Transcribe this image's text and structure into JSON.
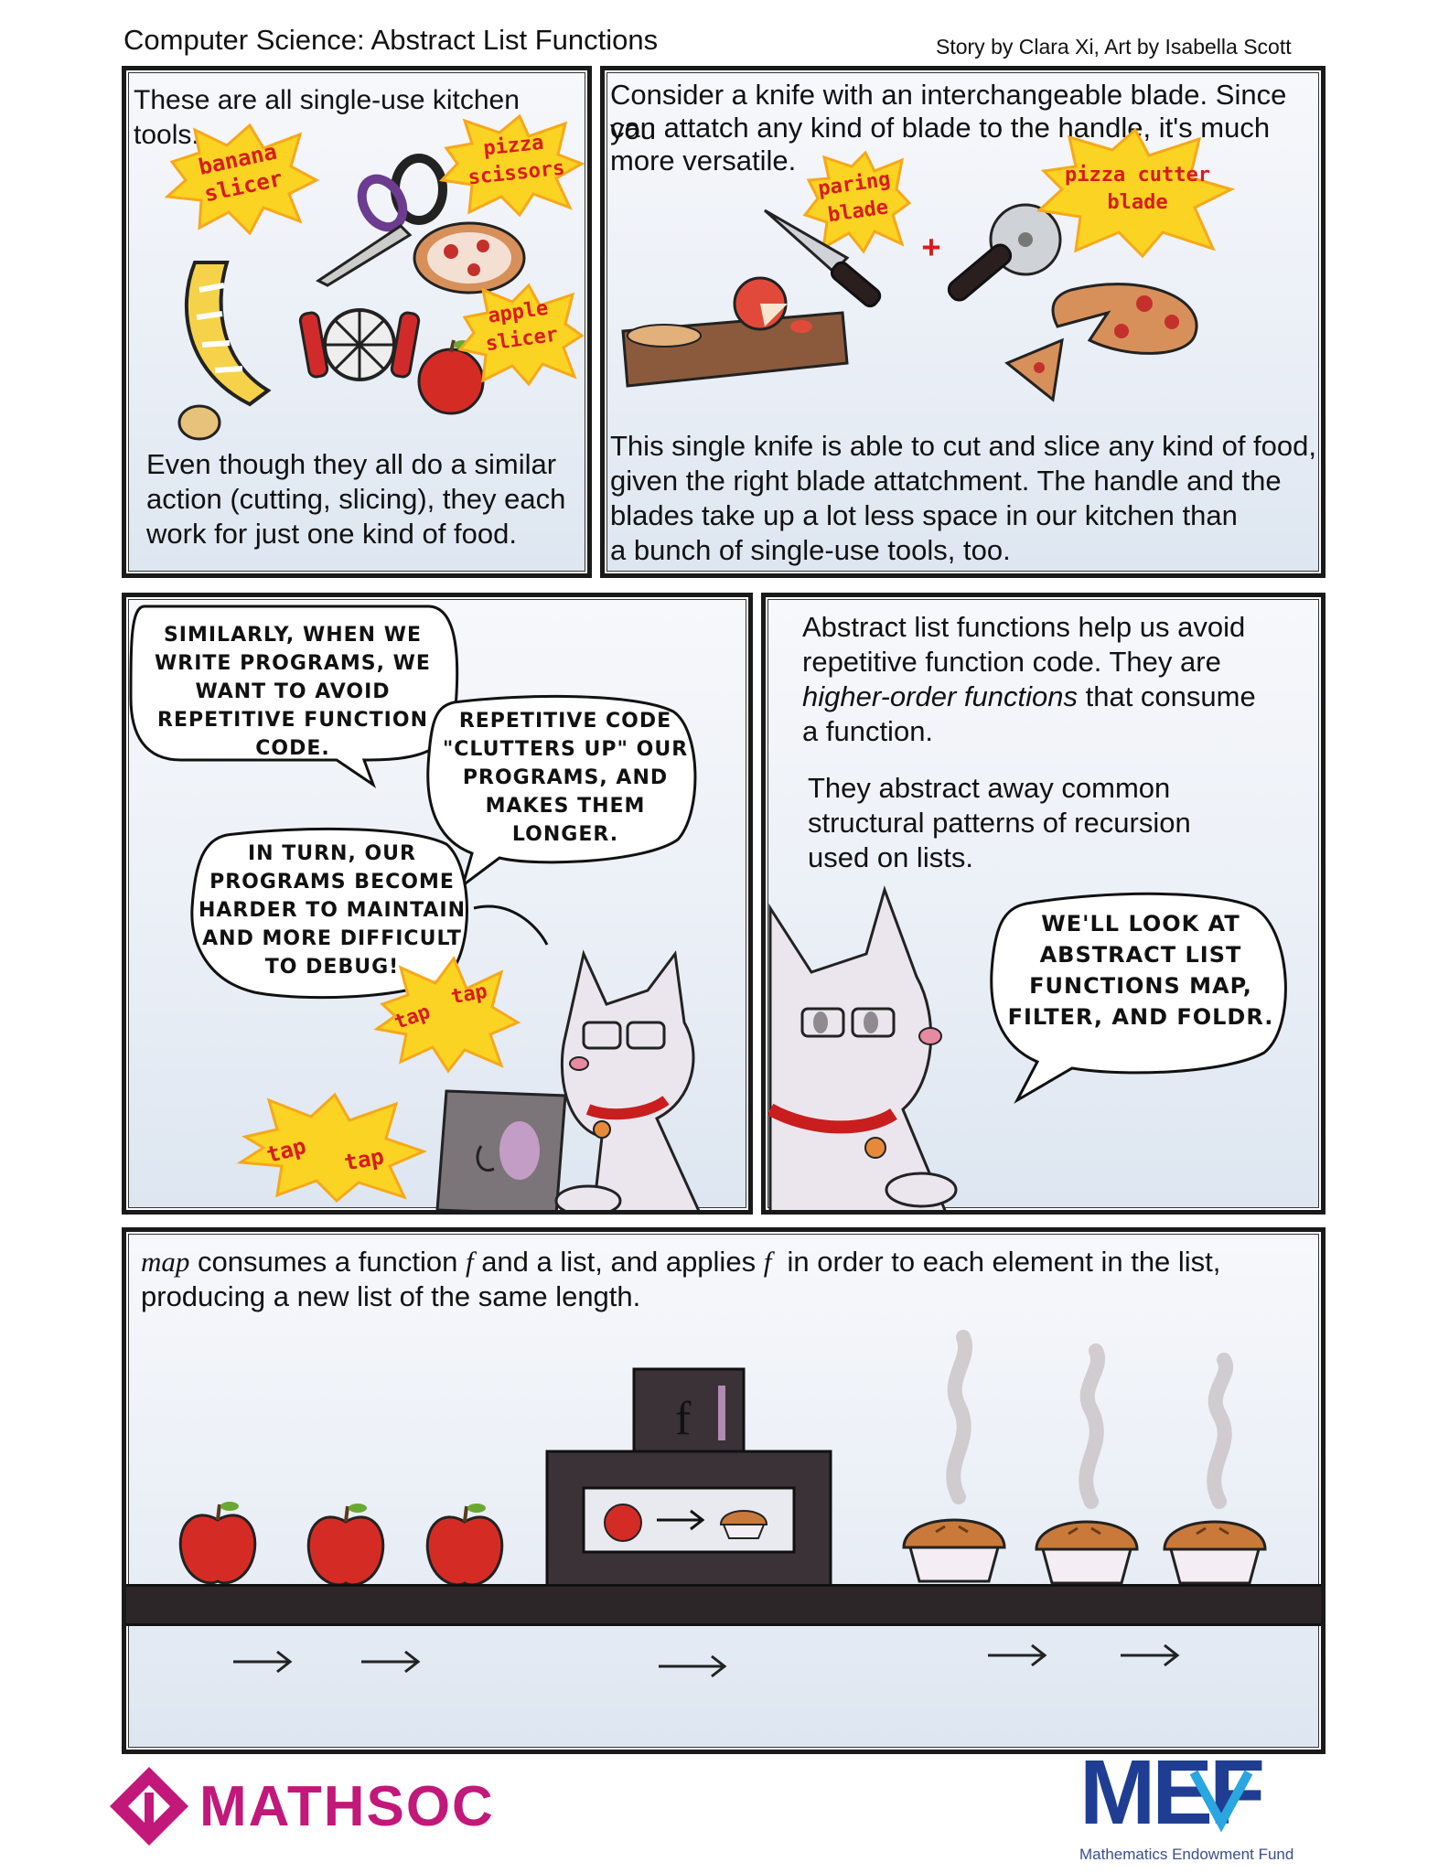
{
  "header": {
    "title": "Computer Science: Abstract List Functions",
    "credits": "Story by Clara Xi, Art by Isabella Scott"
  },
  "panel1": {
    "top_text": "These are all single-use kitchen tools.",
    "labels": {
      "banana": "banana slicer",
      "scissors": "pizza scissors",
      "apple": "apple slicer"
    },
    "bottom_text_1": "Even though they all do a similar",
    "bottom_text_2": "action (cutting, slicing), they each",
    "bottom_text_3": "work for just one kind of food."
  },
  "panel2": {
    "top_text_1": "Consider a knife with an interchangeable blade. Since you",
    "top_text_2": "can attatch any kind of blade to the handle, it's much",
    "top_text_3": "more versatile.",
    "labels": {
      "paring": "paring blade",
      "plus": "+",
      "pizza_cutter": "pizza cutter blade"
    },
    "bottom_text_1": "This single knife is able to cut and slice any kind of food,",
    "bottom_text_2": "given the right blade attatchment. The handle and the",
    "bottom_text_3": "blades take up a lot less space in our kitchen than",
    "bottom_text_4": "a bunch of single-use tools, too."
  },
  "panel3": {
    "bubble1": "Similarly, when we write programs, we want to avoid repetitive function code.",
    "bubble2": "Repetitive code \"clutters up\" our programs, and makes them longer.",
    "bubble3": "In turn, our programs become harder to maintain and more difficult to debug!",
    "tap1": "tap",
    "tap2": "tap",
    "tap3": "tap",
    "tap4": "tap"
  },
  "panel4": {
    "para1_a": "Abstract list functions help us avoid",
    "para1_b": "repetitive function code. They are",
    "para1_c_italic": "higher-order functions",
    "para1_c_rest": " that consume",
    "para1_d": "a function.",
    "para2_a": "They abstract away common",
    "para2_b": "structural patterns of recursion",
    "para2_c": "used on lists.",
    "bubble": "We'll look at abstract list functions map, filter, and foldr."
  },
  "panel5": {
    "line1_map": "map",
    "line1_a": " consumes a function ",
    "line1_f": "f",
    "line1_b": " and a list, and applies ",
    "line1_f2": "f",
    "line1_c": "  in order to each element in the list,",
    "line2": "producing a new list of the same length.",
    "machine_label": "f"
  },
  "footer": {
    "mathsoc": "MATHSOC",
    "mef_logo": "MEF",
    "mef_caption": "Mathematics Endowment Fund"
  },
  "colors": {
    "accent_red": "#d81c1c",
    "burst_yellow": "#fbd323",
    "mathsoc_magenta": "#c2187a",
    "mef_blue": "#1f3e93",
    "mef_cyan": "#2aa6e0"
  }
}
